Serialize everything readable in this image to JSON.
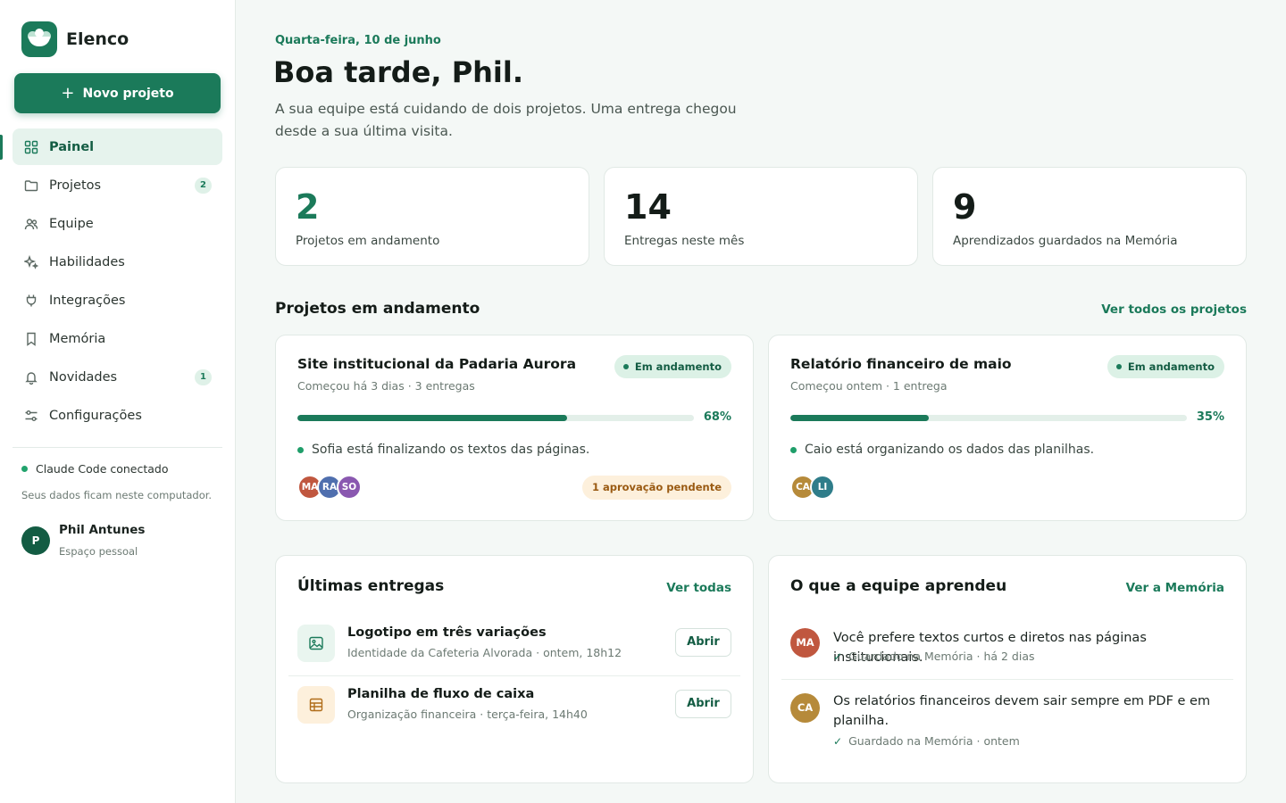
{
  "app": {
    "name": "Elenco"
  },
  "sidebar": {
    "new_project": "Novo projeto",
    "items": [
      {
        "label": "Painel",
        "icon": "grid-icon",
        "active": true
      },
      {
        "label": "Projetos",
        "icon": "folder-icon",
        "badge": "2"
      },
      {
        "label": "Equipe",
        "icon": "users-icon"
      },
      {
        "label": "Habilidades",
        "icon": "sparkles-icon"
      },
      {
        "label": "Integrações",
        "icon": "plug-icon"
      },
      {
        "label": "Memória",
        "icon": "bookmark-icon"
      },
      {
        "label": "Novidades",
        "icon": "bell-icon",
        "badge": "1"
      },
      {
        "label": "Configurações",
        "icon": "sliders-icon"
      }
    ],
    "connection": "Claude Code conectado",
    "local_note": "Seus dados ficam neste computador.",
    "user": {
      "initial": "P",
      "name": "Phil Antunes",
      "space": "Espaço pessoal"
    }
  },
  "header": {
    "date": "Quarta-feira, 10 de junho",
    "greeting": "Boa tarde, Phil.",
    "intro": "A sua equipe está cuidando de dois projetos. Uma entrega chegou desde a sua última visita."
  },
  "stats": [
    {
      "value": "2",
      "label": "Projetos em andamento"
    },
    {
      "value": "14",
      "label": "Entregas neste mês"
    },
    {
      "value": "9",
      "label": "Aprendizados guardados na Memória"
    }
  ],
  "projects_section": {
    "title": "Projetos em andamento",
    "link": "Ver todos os projetos"
  },
  "projects": [
    {
      "title": "Site institucional da Padaria Aurora",
      "meta": "Começou há 3 dias · 3 entregas",
      "status": "Em andamento",
      "progress": 68,
      "progress_label": "68%",
      "activity": "Sofia está finalizando os textos das páginas.",
      "members": [
        {
          "initials": "MA",
          "color": "#c0573f"
        },
        {
          "initials": "RA",
          "color": "#4f6fae"
        },
        {
          "initials": "SO",
          "color": "#8a58b0"
        }
      ],
      "approval": "1 aprovação pendente"
    },
    {
      "title": "Relatório financeiro de maio",
      "meta": "Começou ontem · 1 entrega",
      "status": "Em andamento",
      "progress": 35,
      "progress_label": "35%",
      "activity": "Caio está organizando os dados das planilhas.",
      "members": [
        {
          "initials": "CA",
          "color": "#b68a3a"
        },
        {
          "initials": "LI",
          "color": "#2f7d8a"
        }
      ]
    }
  ],
  "deliveries": {
    "title": "Últimas entregas",
    "link": "Ver todas",
    "items": [
      {
        "name": "Logotipo em três variações",
        "sub": "Identidade da Cafeteria Alvorada · ontem, 18h12",
        "action": "Abrir",
        "icon": "image-icon"
      },
      {
        "name": "Planilha de fluxo de caixa",
        "sub": "Organização financeira · terça-feira, 14h40",
        "action": "Abrir",
        "icon": "table-icon"
      }
    ]
  },
  "learnings": {
    "title": "O que a equipe aprendeu",
    "link": "Ver a Memória",
    "items": [
      {
        "initials": "MA",
        "color": "#c0573f",
        "text": "Você prefere textos curtos e diretos nas páginas institucionais.",
        "saved": "Guardado na Memória · há 2 dias"
      },
      {
        "initials": "CA",
        "color": "#b68a3a",
        "text": "Os relatórios financeiros devem sair sempre em PDF e em planilha.",
        "saved": "Guardado na Memória · ontem"
      }
    ]
  }
}
